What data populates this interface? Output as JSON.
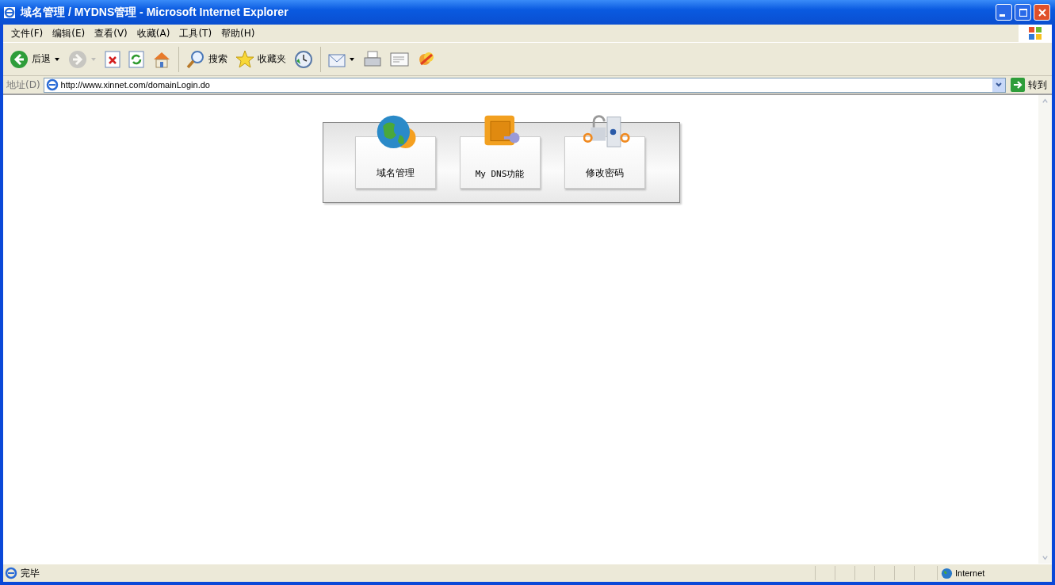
{
  "window": {
    "title": "域名管理 / MYDNS管理 - Microsoft Internet Explorer"
  },
  "menu": [
    "文件(F)",
    "编辑(E)",
    "查看(V)",
    "收藏(A)",
    "工具(T)",
    "帮助(H)"
  ],
  "toolbar": [
    {
      "kind": "back",
      "label": "后退",
      "disabled": false
    },
    {
      "kind": "forward",
      "disabled": true
    },
    {
      "kind": "stop",
      "disabled": false
    },
    {
      "kind": "refresh",
      "disabled": false
    },
    {
      "kind": "home",
      "disabled": false
    },
    {
      "kind": "search",
      "label": "搜索",
      "disabled": false
    },
    {
      "kind": "favorites",
      "label": "收藏夹",
      "disabled": false
    },
    {
      "kind": "history",
      "disabled": false
    },
    {
      "kind": "mail",
      "disabled": false
    },
    {
      "kind": "print",
      "disabled": false
    },
    {
      "kind": "edit",
      "disabled": false
    },
    {
      "kind": "messenger",
      "disabled": false
    }
  ],
  "address": {
    "label": "地址(D)",
    "value": "http://www.xinnet.com/domainLogin.do",
    "go": "转到"
  },
  "tiles": [
    {
      "kind": "globe",
      "label": "域名管理"
    },
    {
      "kind": "safe",
      "label": "My DNS功能"
    },
    {
      "kind": "lock",
      "label": "修改密码"
    }
  ],
  "status_bar": {
    "text": "完毕",
    "zone": "Internet"
  }
}
